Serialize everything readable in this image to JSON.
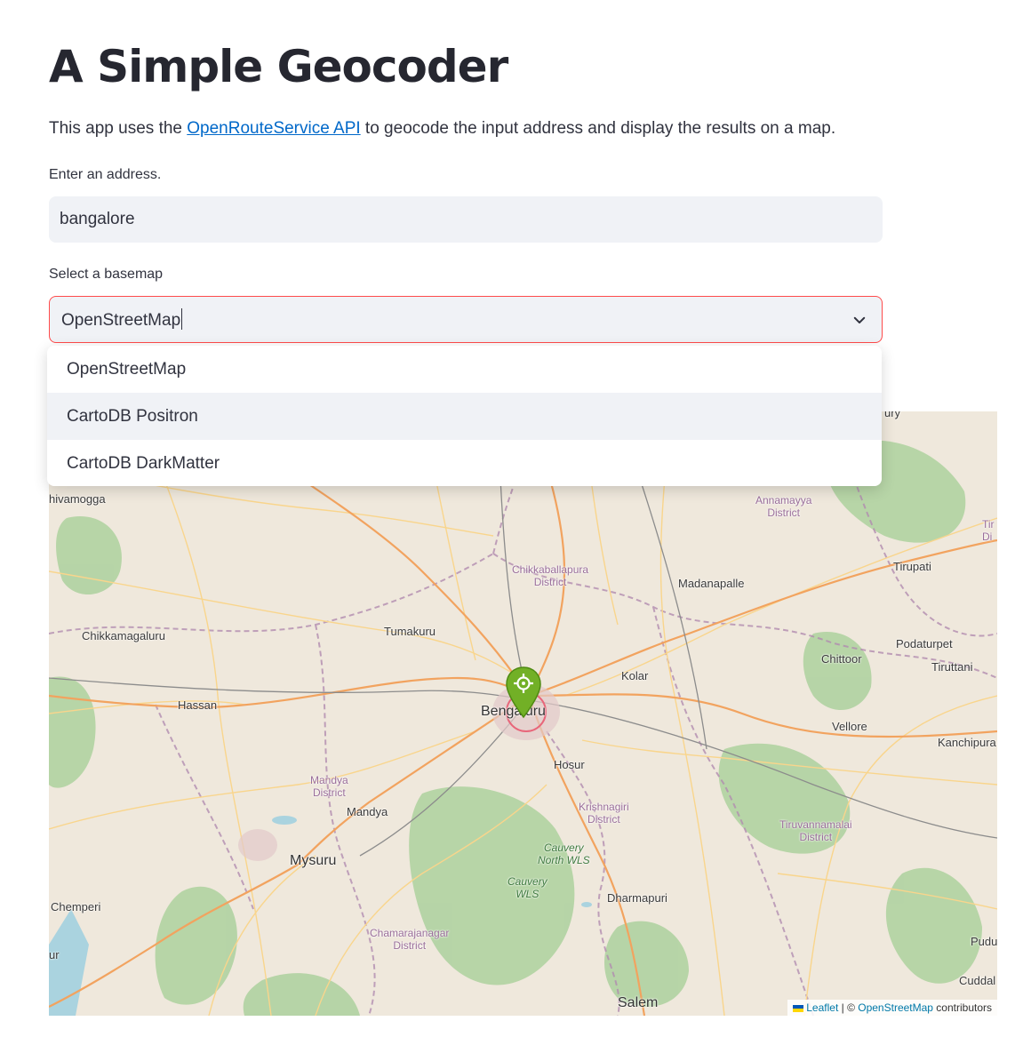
{
  "page": {
    "title": "A Simple Geocoder",
    "intro_before": "This app uses the ",
    "intro_link": "OpenRouteService API",
    "intro_after": " to geocode the input address and display the results on a map."
  },
  "address": {
    "label": "Enter an address.",
    "value": "bangalore"
  },
  "basemap": {
    "label": "Select a basemap",
    "selected": "OpenStreetMap",
    "options": [
      "OpenStreetMap",
      "CartoDB Positron",
      "CartoDB DarkMatter"
    ]
  },
  "map": {
    "places": {
      "shivamogga": "hivamogga",
      "annamayya": "Annamayya\nDistrict",
      "chikkaballapura": "Chikkaballapura\nDistrict",
      "madanapalle": "Madanapalle",
      "tirupati": "Tirupati",
      "chikkamagaluru": "Chikkamagaluru",
      "tumakuru": "Tumakuru",
      "podaturpet": "Podaturpet",
      "tiruttani": "Tiruttani",
      "chittoor": "Chittoor",
      "kolar": "Kolar",
      "hassan": "Hassan",
      "bengaluru": "Bengaluru",
      "vellore": "Vellore",
      "kanchipuram": "Kanchipura",
      "hosur": "Hosur",
      "mandya_district": "Mandya\nDistrict",
      "mandya": "Mandya",
      "krishnagiri": "Krishnagiri\nDistrict",
      "tiruvannamalai": "Tiruvannamalai\nDistrict",
      "cauvery_north": "Cauvery\nNorth WLS",
      "mysuru": "Mysuru",
      "cauvery_wls": "Cauvery\nWLS",
      "dharmapuri": "Dharmapuri",
      "chemperi": "Chemperi",
      "chamarajanagar": "Chamarajanagar\nDistrict",
      "ur": "ur",
      "salem": "Salem",
      "pudu": "Pudu",
      "cuddal": "Cuddal",
      "tiru_edge": "Tir\nDi",
      "ury": "ury"
    },
    "attribution": {
      "leaflet": "Leaflet",
      "sep": " | © ",
      "osm": "OpenStreetMap",
      "suffix": " contributors"
    },
    "colors": {
      "land": "#efe8dc",
      "forest": "#add19e",
      "road_major": "#f2a35f",
      "road_minor": "#f9d58c",
      "boundary": "#b28cb0",
      "marker": "#72b026"
    }
  }
}
